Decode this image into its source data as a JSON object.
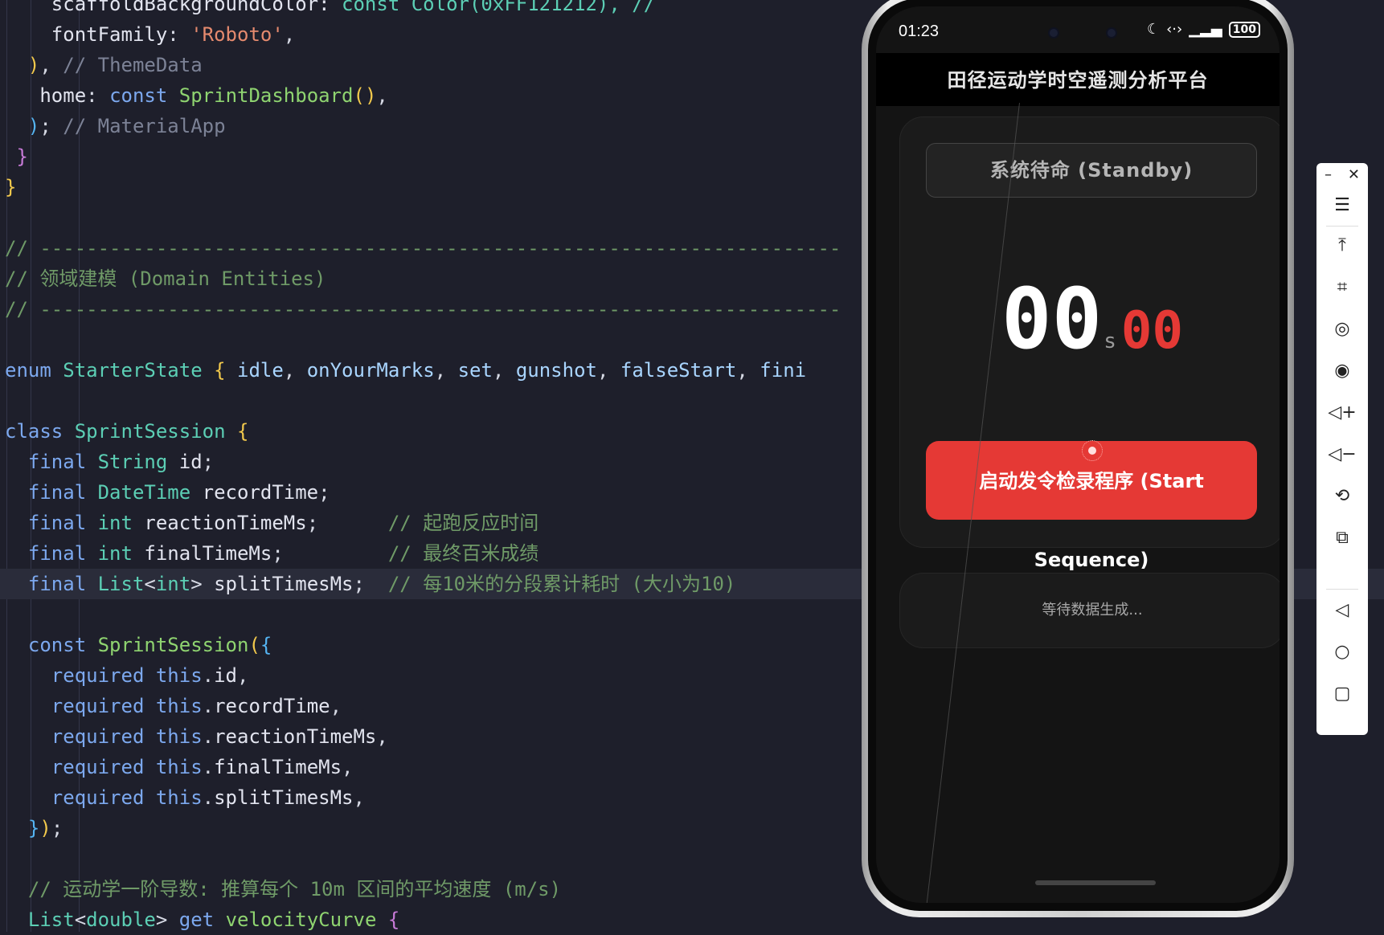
{
  "editor": {
    "lines": [
      {
        "tokens": [
          {
            "t": "    scaffoldBackgroundColor: ",
            "c": "t-prop"
          },
          {
            "t": "const Color(0xFF121212), // ",
            "c": "t-type"
          }
        ]
      },
      {
        "tokens": [
          {
            "t": "    fontFamily",
            "c": "t-prop"
          },
          {
            "t": ": ",
            "c": "t-punc"
          },
          {
            "t": "'Roboto'",
            "c": "t-str"
          },
          {
            "t": ",",
            "c": "t-punc"
          }
        ]
      },
      {
        "tokens": [
          {
            "t": "  ",
            "c": "t-punc"
          },
          {
            "t": ")",
            "c": "t-paren"
          },
          {
            "t": ", ",
            "c": "t-punc"
          },
          {
            "t": "// ThemeData",
            "c": "t-comgrey"
          }
        ]
      },
      {
        "tokens": [
          {
            "t": "   home",
            "c": "t-prop"
          },
          {
            "t": ": ",
            "c": "t-punc"
          },
          {
            "t": "const ",
            "c": "t-key"
          },
          {
            "t": "SprintDashboard",
            "c": "t-fn"
          },
          {
            "t": "()",
            "c": "t-paren"
          },
          {
            "t": ",",
            "c": "t-punc"
          }
        ]
      },
      {
        "tokens": [
          {
            "t": "  ",
            "c": "t-punc"
          },
          {
            "t": ")",
            "c": "t-brace2"
          },
          {
            "t": "; ",
            "c": "t-punc"
          },
          {
            "t": "// MaterialApp",
            "c": "t-comgrey"
          }
        ]
      },
      {
        "tokens": [
          {
            "t": " ",
            "c": "t-punc"
          },
          {
            "t": "}",
            "c": "t-brace"
          }
        ]
      },
      {
        "tokens": [
          {
            "t": "}",
            "c": "t-paren"
          }
        ]
      },
      {
        "tokens": []
      },
      {
        "tokens": [
          {
            "t": "// ---------------------------------------------------------------------",
            "c": "t-com"
          }
        ]
      },
      {
        "tokens": [
          {
            "t": "// 领域建模 (Domain Entities)",
            "c": "t-com"
          }
        ]
      },
      {
        "tokens": [
          {
            "t": "// ---------------------------------------------------------------------",
            "c": "t-com"
          }
        ]
      },
      {
        "tokens": []
      },
      {
        "tokens": [
          {
            "t": "enum ",
            "c": "t-key"
          },
          {
            "t": "StarterState ",
            "c": "t-type"
          },
          {
            "t": "{ ",
            "c": "t-paren"
          },
          {
            "t": "idle",
            "c": "t-enum"
          },
          {
            "t": ", ",
            "c": "t-punc"
          },
          {
            "t": "onYourMarks",
            "c": "t-enum"
          },
          {
            "t": ", ",
            "c": "t-punc"
          },
          {
            "t": "set",
            "c": "t-enum"
          },
          {
            "t": ", ",
            "c": "t-punc"
          },
          {
            "t": "gunshot",
            "c": "t-enum"
          },
          {
            "t": ", ",
            "c": "t-punc"
          },
          {
            "t": "falseStart",
            "c": "t-enum"
          },
          {
            "t": ", ",
            "c": "t-punc"
          },
          {
            "t": "fini",
            "c": "t-enum"
          }
        ]
      },
      {
        "tokens": []
      },
      {
        "tokens": [
          {
            "t": "class ",
            "c": "t-key"
          },
          {
            "t": "SprintSession ",
            "c": "t-type"
          },
          {
            "t": "{",
            "c": "t-paren"
          }
        ]
      },
      {
        "tokens": [
          {
            "t": "  final ",
            "c": "t-key"
          },
          {
            "t": "String ",
            "c": "t-type"
          },
          {
            "t": "id",
            "c": "t-prop"
          },
          {
            "t": ";",
            "c": "t-punc"
          }
        ]
      },
      {
        "tokens": [
          {
            "t": "  final ",
            "c": "t-key"
          },
          {
            "t": "DateTime ",
            "c": "t-type"
          },
          {
            "t": "recordTime",
            "c": "t-prop"
          },
          {
            "t": ";",
            "c": "t-punc"
          }
        ]
      },
      {
        "tokens": [
          {
            "t": "  final ",
            "c": "t-key"
          },
          {
            "t": "int ",
            "c": "t-type"
          },
          {
            "t": "reactionTimeMs",
            "c": "t-prop"
          },
          {
            "t": ";      ",
            "c": "t-punc"
          },
          {
            "t": "// 起跑反应时间",
            "c": "t-com"
          }
        ]
      },
      {
        "tokens": [
          {
            "t": "  final ",
            "c": "t-key"
          },
          {
            "t": "int ",
            "c": "t-type"
          },
          {
            "t": "finalTimeMs",
            "c": "t-prop"
          },
          {
            "t": ";         ",
            "c": "t-punc"
          },
          {
            "t": "// 最终百米成绩",
            "c": "t-com"
          }
        ]
      },
      {
        "tokens": [
          {
            "t": "  final ",
            "c": "t-key"
          },
          {
            "t": "List",
            "c": "t-type"
          },
          {
            "t": "<",
            "c": "t-punc"
          },
          {
            "t": "int",
            "c": "t-type"
          },
          {
            "t": "> ",
            "c": "t-punc"
          },
          {
            "t": "splitTimesMs",
            "c": "t-prop"
          },
          {
            "t": ";  ",
            "c": "t-punc"
          },
          {
            "t": "// 每10米的分段累计耗时 (大小为10)",
            "c": "t-com"
          }
        ],
        "active": true
      },
      {
        "tokens": []
      },
      {
        "tokens": [
          {
            "t": "  const ",
            "c": "t-key"
          },
          {
            "t": "SprintSession",
            "c": "t-fn"
          },
          {
            "t": "(",
            "c": "t-paren"
          },
          {
            "t": "{",
            "c": "t-brace2"
          }
        ]
      },
      {
        "tokens": [
          {
            "t": "    required ",
            "c": "t-key"
          },
          {
            "t": "this",
            "c": "t-key"
          },
          {
            "t": ".",
            "c": "t-punc"
          },
          {
            "t": "id",
            "c": "t-prop"
          },
          {
            "t": ",",
            "c": "t-punc"
          }
        ]
      },
      {
        "tokens": [
          {
            "t": "    required ",
            "c": "t-key"
          },
          {
            "t": "this",
            "c": "t-key"
          },
          {
            "t": ".",
            "c": "t-punc"
          },
          {
            "t": "recordTime",
            "c": "t-prop"
          },
          {
            "t": ",",
            "c": "t-punc"
          }
        ]
      },
      {
        "tokens": [
          {
            "t": "    required ",
            "c": "t-key"
          },
          {
            "t": "this",
            "c": "t-key"
          },
          {
            "t": ".",
            "c": "t-punc"
          },
          {
            "t": "reactionTimeMs",
            "c": "t-prop"
          },
          {
            "t": ",",
            "c": "t-punc"
          }
        ]
      },
      {
        "tokens": [
          {
            "t": "    required ",
            "c": "t-key"
          },
          {
            "t": "this",
            "c": "t-key"
          },
          {
            "t": ".",
            "c": "t-punc"
          },
          {
            "t": "finalTimeMs",
            "c": "t-prop"
          },
          {
            "t": ",",
            "c": "t-punc"
          }
        ]
      },
      {
        "tokens": [
          {
            "t": "    required ",
            "c": "t-key"
          },
          {
            "t": "this",
            "c": "t-key"
          },
          {
            "t": ".",
            "c": "t-punc"
          },
          {
            "t": "splitTimesMs",
            "c": "t-prop"
          },
          {
            "t": ",",
            "c": "t-punc"
          }
        ]
      },
      {
        "tokens": [
          {
            "t": "  ",
            "c": "t-punc"
          },
          {
            "t": "}",
            "c": "t-brace2"
          },
          {
            "t": ")",
            "c": "t-paren"
          },
          {
            "t": ";",
            "c": "t-punc"
          }
        ]
      },
      {
        "tokens": []
      },
      {
        "tokens": [
          {
            "t": "  // 运动学一阶导数: 推算每个 10m 区间的平均速度 (m/s)",
            "c": "t-com"
          }
        ]
      },
      {
        "tokens": [
          {
            "t": "  List",
            "c": "t-type"
          },
          {
            "t": "<",
            "c": "t-punc"
          },
          {
            "t": "double",
            "c": "t-type"
          },
          {
            "t": "> ",
            "c": "t-punc"
          },
          {
            "t": "get ",
            "c": "t-key"
          },
          {
            "t": "velocityCurve ",
            "c": "t-fn"
          },
          {
            "t": "{",
            "c": "t-brace"
          }
        ]
      }
    ]
  },
  "phone": {
    "status_time": "01:23",
    "battery": "100",
    "app_title": "田径运动学时空遥测分析平台",
    "status_text": "系统待命 (Standby)",
    "timer_seconds": "00",
    "timer_unit": "s",
    "timer_ms": "00",
    "start_button_label": "启动发令检录程序 (Start Sequence)",
    "data_placeholder": "等待数据生成..."
  },
  "toolbar": {
    "icons": [
      "menu-icon",
      "pin-top-icon",
      "crop-icon",
      "rotate-icon",
      "screenshot-icon",
      "volume-up-icon",
      "volume-down-icon",
      "rotate-device-icon",
      "multi-device-icon",
      "back-icon",
      "home-icon",
      "recents-icon"
    ]
  },
  "colors": {
    "accent_red": "#e53935",
    "editor_bg": "#1e1f2b",
    "app_bg": "#141414"
  }
}
